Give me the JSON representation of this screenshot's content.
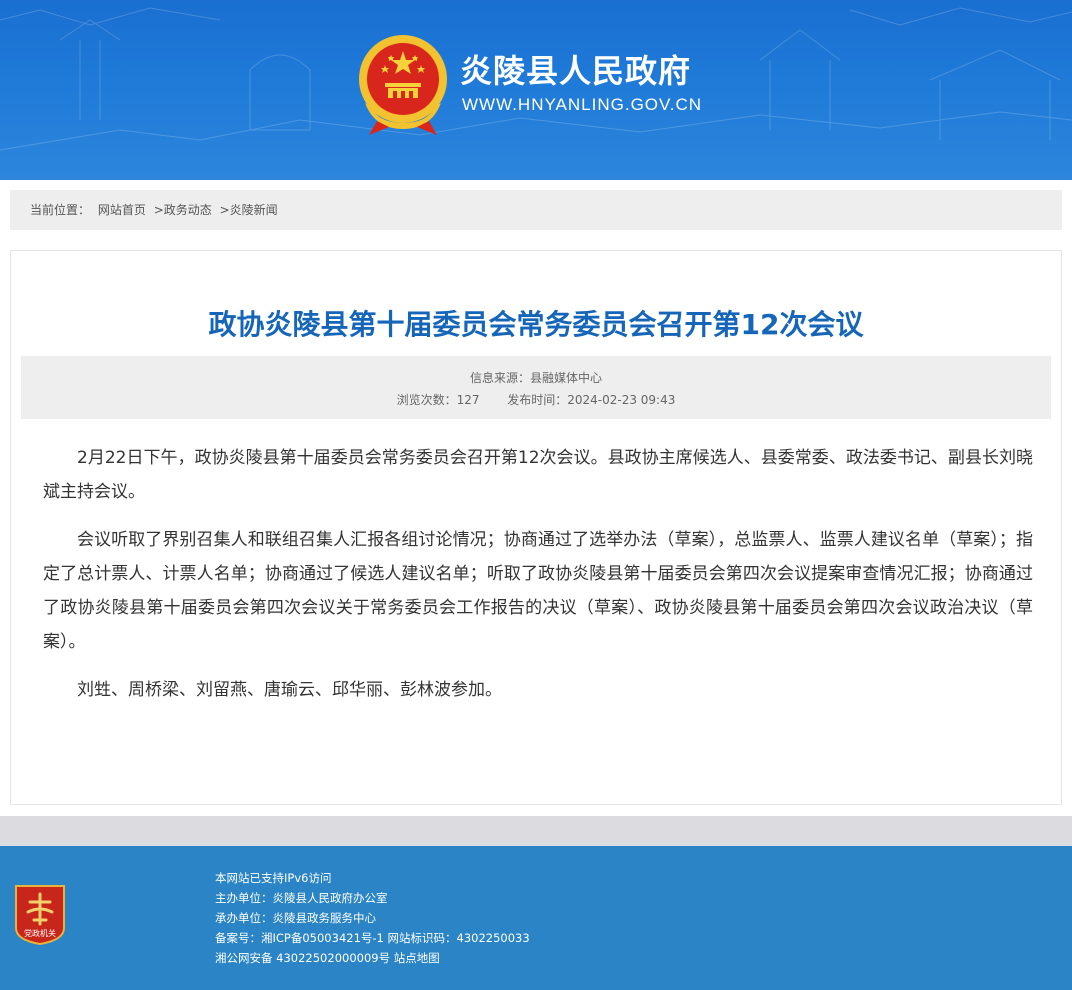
{
  "header": {
    "site_title": "炎陵县人民政府",
    "site_url": "WWW.HNYANLING.GOV.CN",
    "bg_color": "#1f7ad8"
  },
  "breadcrumb": {
    "prefix": "当前位置：",
    "items": [
      "网站首页",
      ">政务动态",
      ">炎陵新闻"
    ]
  },
  "article": {
    "title": "政协炎陵县第十届委员会常务委员会召开第12次会议",
    "title_color": "#1565b8",
    "source_label": "信息来源：",
    "source_value": "县融媒体中心",
    "views_label": "浏览次数：",
    "views_value": "127",
    "date_label": "发布时间：",
    "date_value": "2024-02-23 09:43",
    "paragraphs": [
      "2月22日下午，政协炎陵县第十届委员会常务委员会召开第12次会议。县政协主席候选人、县委常委、政法委书记、副县长刘晓斌主持会议。",
      "会议听取了界别召集人和联组召集人汇报各组讨论情况；协商通过了选举办法（草案），总监票人、监票人建议名单（草案）；指定了总计票人、计票人名单；协商通过了候选人建议名单；听取了政协炎陵县第十届委员会第四次会议提案审查情况汇报；协商通过了政协炎陵县第十届委员会第四次会议关于常务委员会工作报告的决议（草案）、政协炎陵县第十届委员会第四次会议政治决议（草案）。",
      "刘甡、周桥梁、刘留燕、唐瑜云、邱华丽、彭林波参加。"
    ]
  },
  "footer": {
    "bg_color": "#2a84c6",
    "ipv6": "本网站已支持IPv6访问",
    "sponsor": "主办单位：炎陵县人民政府办公室",
    "organizer": "承办单位：炎陵县政务服务中心",
    "icp": "备案号：湘ICP备05003421号-1 网站标识码：4302250033",
    "police_prefix": "湘公网安备 43022502000009号 ",
    "sitemap": "站点地图",
    "party_logo_text": "党政机关"
  }
}
